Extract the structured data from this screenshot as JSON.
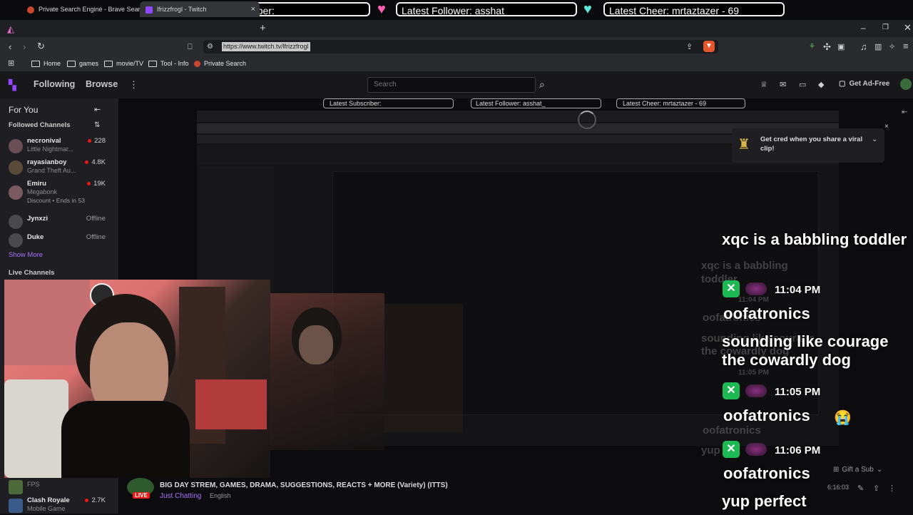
{
  "overlay": {
    "subscriber_label": "Latest Subscriber:",
    "follower_label": "Latest Follower: asshat_",
    "cheer_label": "Latest Cheer: mrtaztazer - 69"
  },
  "browser": {
    "tabs": [
      {
        "title": "Private Search Engine - Brave Search"
      },
      {
        "title": "lfrizzfrogl - Twitch"
      }
    ],
    "url": "https://www.twitch.tv/lfrizzfrogl",
    "bookmarks": [
      "Home",
      "games",
      "movie/TV",
      "Tool - Info",
      "Private Search"
    ]
  },
  "twitch": {
    "nav": {
      "following": "Following",
      "browse": "Browse",
      "search_placeholder": "Search",
      "ad_free": "Get Ad-Free"
    },
    "sidebar": {
      "for_you": "For You",
      "followed_channels": "Followed Channels",
      "channels": [
        {
          "name": "necronival",
          "game": "Little Nightmar...",
          "viewers": "228",
          "live": true
        },
        {
          "name": "rayasianboy",
          "game": "Grand Theft Au...",
          "viewers": "4.8K",
          "live": true
        },
        {
          "name": "Emiru",
          "game": "Megabonk",
          "viewers": "19K",
          "live": true,
          "extra": "Discount • Ends in 53"
        },
        {
          "name": "Jynxzi",
          "game": "",
          "viewers": "Offline",
          "live": false
        },
        {
          "name": "Duke",
          "game": "",
          "viewers": "Offline",
          "live": false
        }
      ],
      "show_more": "Show More",
      "live_channels": "Live Channels",
      "bottom_channels": [
        {
          "name": "",
          "game": "FPS",
          "viewers": ""
        },
        {
          "name": "Clash Royale",
          "game": "Mobile Game",
          "viewers": "2.7K"
        }
      ]
    },
    "viral_prompt": "Get cred when you share a viral clip!",
    "stream": {
      "title": "BIG DAY STREM, GAMES, DRAMA, SUGGESTIONS, REACTS + MORE (Variety) (ITTS)",
      "category": "Just Chatting",
      "language": "English",
      "live_badge": "LIVE",
      "gift_sub": "Gift a Sub",
      "uptime": "6:16:03"
    }
  },
  "chat": [
    {
      "kind": "message",
      "text": "xqc is a babbling toddler"
    },
    {
      "kind": "meta",
      "time": "11:04 PM",
      "user": "oofatronics"
    },
    {
      "kind": "message",
      "text": "sounding like courage the cowardly dog"
    },
    {
      "kind": "meta",
      "time": "11:05 PM",
      "user": "oofatronics",
      "emoji": "😭"
    },
    {
      "kind": "meta",
      "time": "11:06 PM",
      "user": "oofatronics"
    },
    {
      "kind": "message",
      "text": "yup perfect"
    }
  ],
  "chat_ghost": {
    "line1": "xqc is a babbling",
    "line2": "toddler",
    "time1": "11:04 PM",
    "user1": "oofatronics",
    "line3": "sounding like courage",
    "line4": "the cowardly dog",
    "time2": "11:05 PM",
    "user2": "oofatronics",
    "line5": "yup"
  },
  "colors": {
    "accent": "#a970ff",
    "live": "#e91916",
    "badge": "#1db954"
  }
}
